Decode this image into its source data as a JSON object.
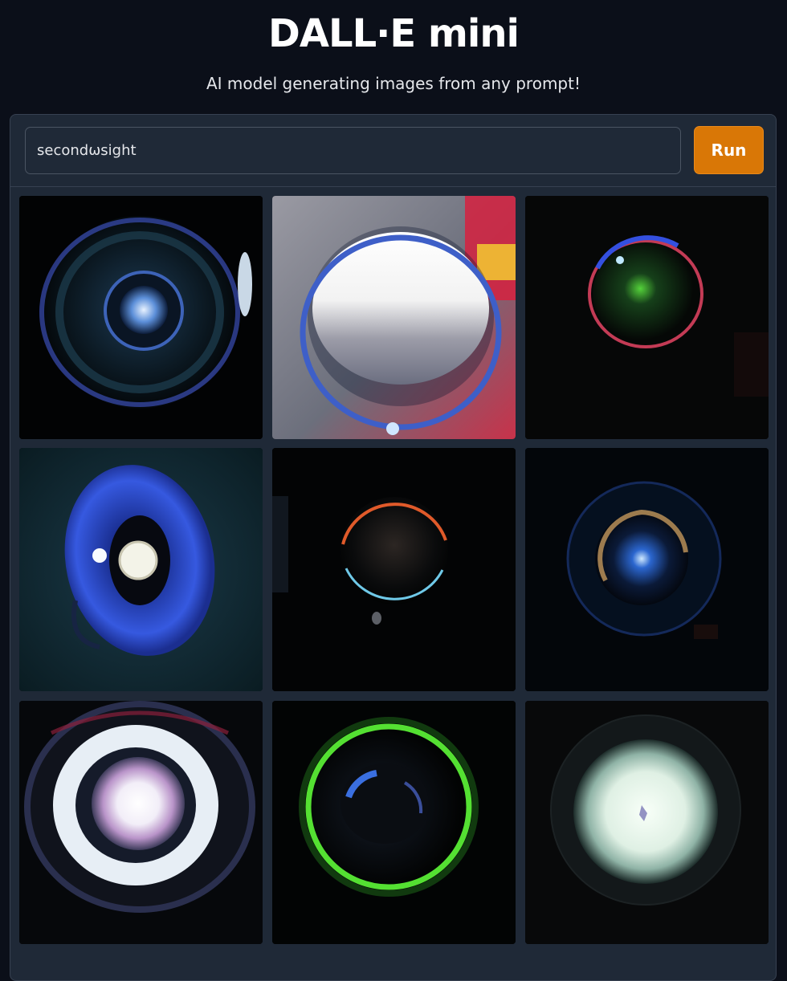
{
  "header": {
    "title": "DALL·E mini",
    "subtitle": "AI model generating images from any prompt!"
  },
  "prompt": {
    "value": "secondωsight"
  },
  "run_button": {
    "label": "Run"
  },
  "gallery": {
    "images": [
      {
        "icon": "glowing-eye-image"
      },
      {
        "icon": "glass-sphere-image"
      },
      {
        "icon": "dark-lens-image"
      },
      {
        "icon": "blue-iris-image"
      },
      {
        "icon": "glass-ball-image"
      },
      {
        "icon": "dim-lens-image"
      },
      {
        "icon": "bright-iris-image"
      },
      {
        "icon": "green-ring-image"
      },
      {
        "icon": "white-glow-image"
      }
    ]
  },
  "colors": {
    "background": "#0b0f19",
    "panel": "#1f2937",
    "accent": "#d97706"
  }
}
